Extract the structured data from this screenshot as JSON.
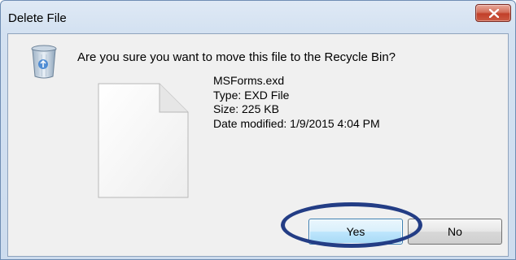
{
  "window": {
    "title": "Delete File",
    "close_icon": "close-x-icon"
  },
  "dialog": {
    "icon": "recycle-bin-icon",
    "question": "Are you sure you want to move this file to the Recycle Bin?",
    "file_icon": "blank-document-icon",
    "file": {
      "name": "MSForms.exd",
      "type": "Type: EXD File",
      "size": "Size: 225 KB",
      "date_modified": "Date modified: 1/9/2015 4:04 PM"
    }
  },
  "buttons": {
    "yes_label": "Yes",
    "no_label": "No"
  },
  "annotation": {
    "highlight_color": "#233d85",
    "highlights": "yes-button"
  },
  "colors": {
    "close_button": "#c1402a",
    "title_bar": "#d3e1f1",
    "client_area": "#f0f0f0"
  }
}
